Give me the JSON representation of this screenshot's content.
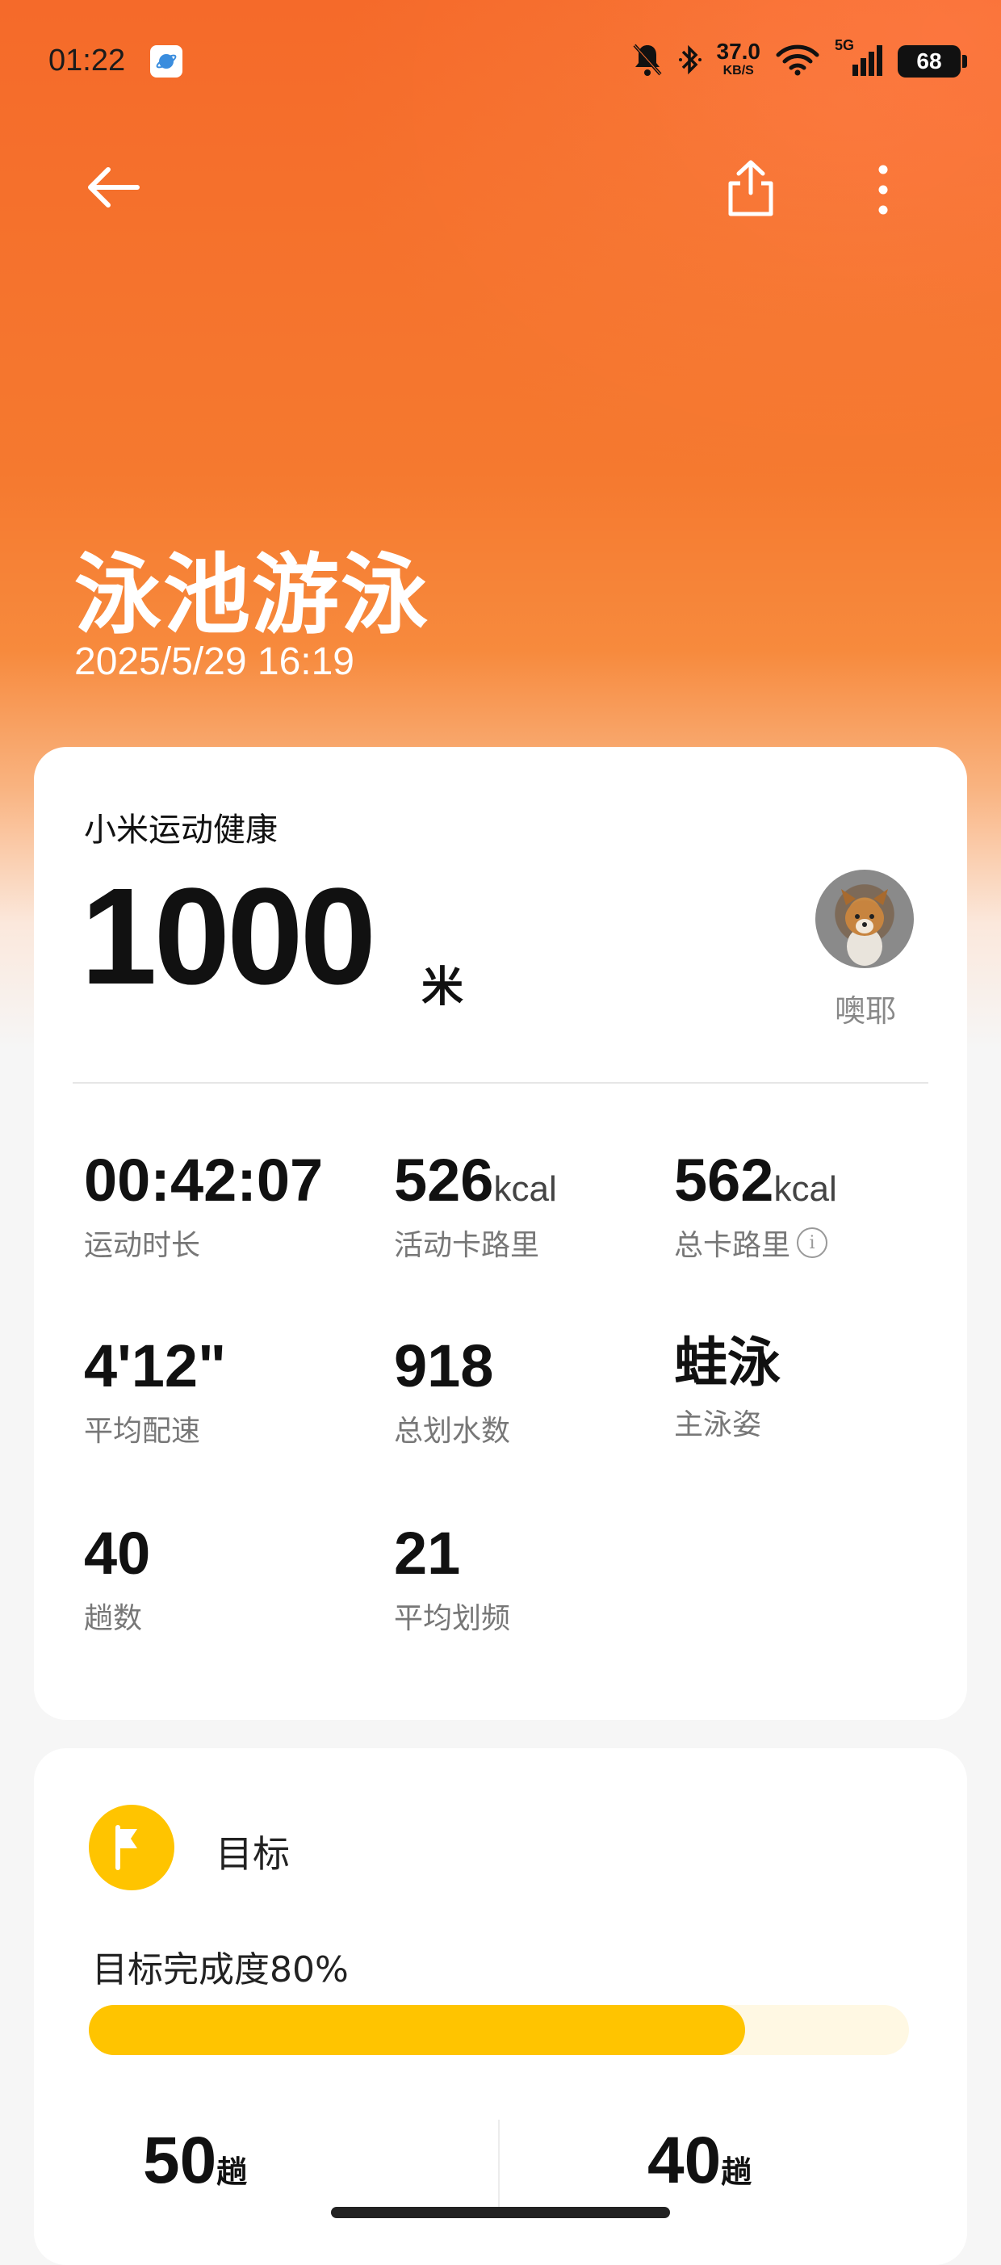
{
  "status_bar": {
    "time": "01:22",
    "net_speed_value": "37.0",
    "net_speed_unit": "KB/S",
    "network_type": "5G",
    "battery": "68"
  },
  "header": {
    "workout_type": "泳池游泳",
    "datetime": "2025/5/29 16:19"
  },
  "summary": {
    "source_app": "小米运动健康",
    "distance_value": "1000",
    "distance_unit": "米",
    "user_name": "噢耶"
  },
  "stats": [
    {
      "value": "00:42:07",
      "unit": "",
      "label": "运动时长"
    },
    {
      "value": "526",
      "unit": "kcal",
      "label": "活动卡路里"
    },
    {
      "value": "562",
      "unit": "kcal",
      "label": "总卡路里"
    },
    {
      "value": "4'12\"",
      "unit": "",
      "label": "平均配速"
    },
    {
      "value": "918",
      "unit": "",
      "label": "总划水数"
    },
    {
      "value": "蛙泳",
      "unit": "",
      "label": "主泳姿"
    },
    {
      "value": "40",
      "unit": "",
      "label": "趟数"
    },
    {
      "value": "21",
      "unit": "",
      "label": "平均划频"
    }
  ],
  "goal": {
    "title": "目标",
    "progress_label": "目标完成度80%",
    "progress_fraction": 0.8,
    "target_value": "50",
    "target_unit": "趟",
    "actual_value": "40",
    "actual_unit": "趟"
  },
  "colors": {
    "accent": "#f56a2a",
    "goal_yellow": "#ffc400"
  }
}
